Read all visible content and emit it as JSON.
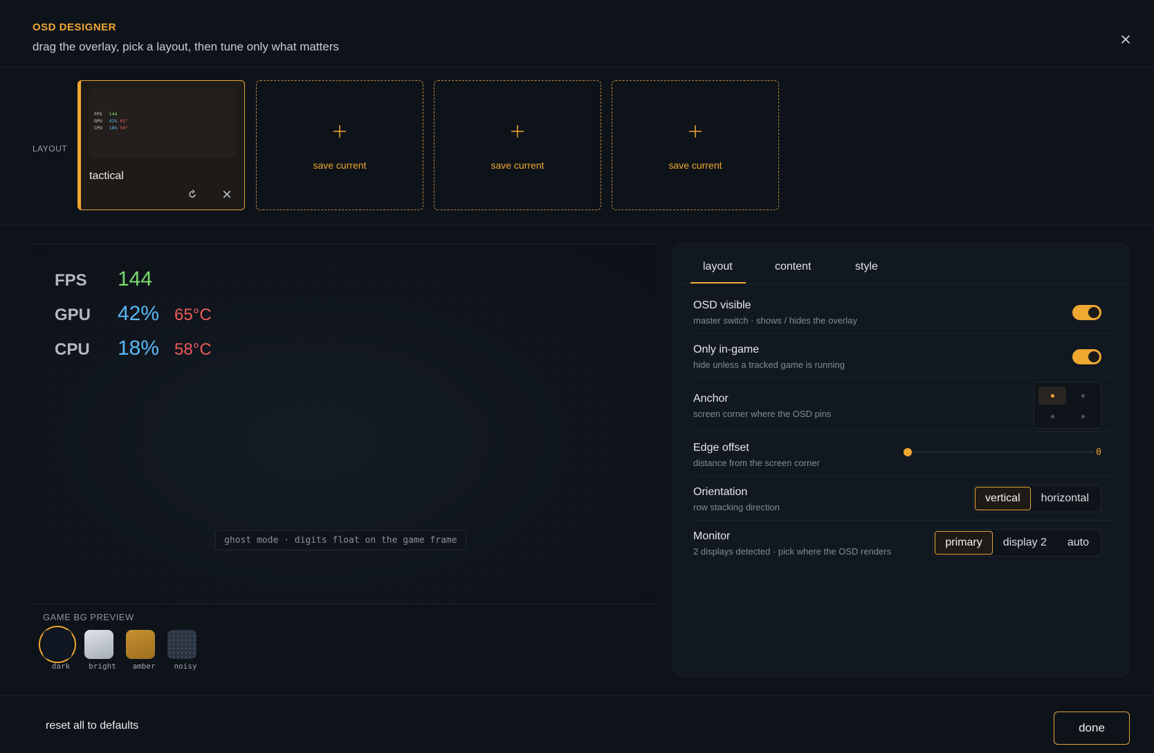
{
  "header": {
    "title": "OSD DESIGNER",
    "subtitle": "drag the overlay, pick a layout, then tune only what matters",
    "close_icon": "close-icon"
  },
  "layout_row": {
    "label": "LAYOUT",
    "active_slot": {
      "name": "tactical",
      "thumb_rows": [
        {
          "key": "FPS",
          "val": "144",
          "temp": ""
        },
        {
          "key": "GPU",
          "val": "42%",
          "temp": "65°"
        },
        {
          "key": "CPU",
          "val": "18%",
          "temp": "58°"
        }
      ],
      "refresh_icon": "refresh-icon",
      "delete_icon": "close-icon"
    },
    "empty_slots": [
      {
        "label": "save current"
      },
      {
        "label": "save current"
      },
      {
        "label": "save current"
      }
    ]
  },
  "preview": {
    "rows": [
      {
        "key": "FPS",
        "val": "144",
        "temp": "",
        "color": "#7bdc6f"
      },
      {
        "key": "GPU",
        "val": "42%",
        "temp": "65°C",
        "color": "#5ab8f5"
      },
      {
        "key": "CPU",
        "val": "18%",
        "temp": "58°C",
        "color": "#5ab8f5"
      }
    ],
    "ghost_text": "ghost mode · digits float on the game frame"
  },
  "bg_preview": {
    "label": "GAME BG PREVIEW",
    "swatches": [
      {
        "name": "dark",
        "color": "#101722",
        "selected": true
      },
      {
        "name": "bright",
        "color": "#c9ced6",
        "selected": false
      },
      {
        "name": "amber",
        "color": "#b8862f",
        "selected": false
      },
      {
        "name": "noisy",
        "color": "#2a3340",
        "selected": false
      }
    ]
  },
  "panel": {
    "tabs": [
      {
        "label": "layout",
        "active": true
      },
      {
        "label": "content",
        "active": false
      },
      {
        "label": "style",
        "active": false
      }
    ],
    "settings": {
      "osd_visible": {
        "label": "OSD visible",
        "desc": "master switch · shows / hides the overlay",
        "on": true
      },
      "only_in_game": {
        "label": "Only in-game",
        "desc": "hide unless a tracked game is running",
        "on": true
      },
      "anchor": {
        "label": "Anchor",
        "desc": "screen corner where the OSD pins",
        "selected": "top-left"
      },
      "edge_offset": {
        "label": "Edge offset",
        "desc": "distance from the screen corner",
        "value": "0"
      },
      "orientation": {
        "label": "Orientation",
        "desc": "row stacking direction",
        "options": [
          "vertical",
          "horizontal"
        ],
        "selected": "vertical"
      },
      "monitor": {
        "label": "Monitor",
        "desc": "2 displays detected · pick where the OSD renders",
        "options": [
          "primary",
          "display 2",
          "auto"
        ],
        "selected": "primary"
      }
    }
  },
  "footer": {
    "reset_label": "reset all to defaults",
    "done_label": "done"
  },
  "colors": {
    "accent": "#f0a832",
    "fps": "#7bdc6f",
    "load": "#5ab8f5",
    "temp": "#ef5b5b"
  }
}
